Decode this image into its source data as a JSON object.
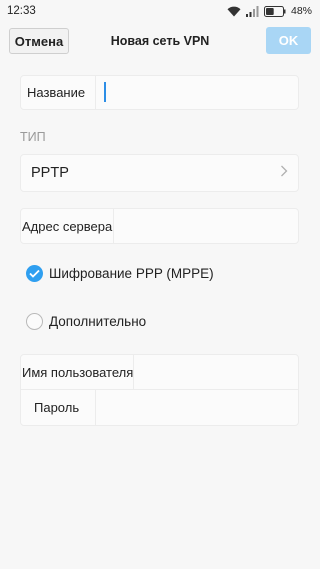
{
  "status_bar": {
    "time": "12:33",
    "battery_percent": "48%",
    "icons": [
      "wifi-icon",
      "signal-icon",
      "battery-icon"
    ],
    "battery_level": 0.48
  },
  "header": {
    "cancel_label": "Отмена",
    "title": "Новая сеть VPN",
    "ok_label": "OK"
  },
  "form": {
    "name_label": "Название",
    "name_value": "",
    "type_section_label": "ТИП",
    "type_value": "PPTP",
    "server_label": "Адрес сервера",
    "server_value": "",
    "mppe_label": "Шифрование PPP (MPPE)",
    "mppe_checked": true,
    "advanced_label": "Дополнительно",
    "advanced_checked": false,
    "username_label": "Имя пользователя",
    "username_value": "",
    "password_label": "Пароль",
    "password_value": ""
  },
  "colors": {
    "accent": "#2f9ff0",
    "ok_button_disabled": "#a9d6f5",
    "background": "#f7f7f7",
    "cursor": "#2d8ee6"
  }
}
